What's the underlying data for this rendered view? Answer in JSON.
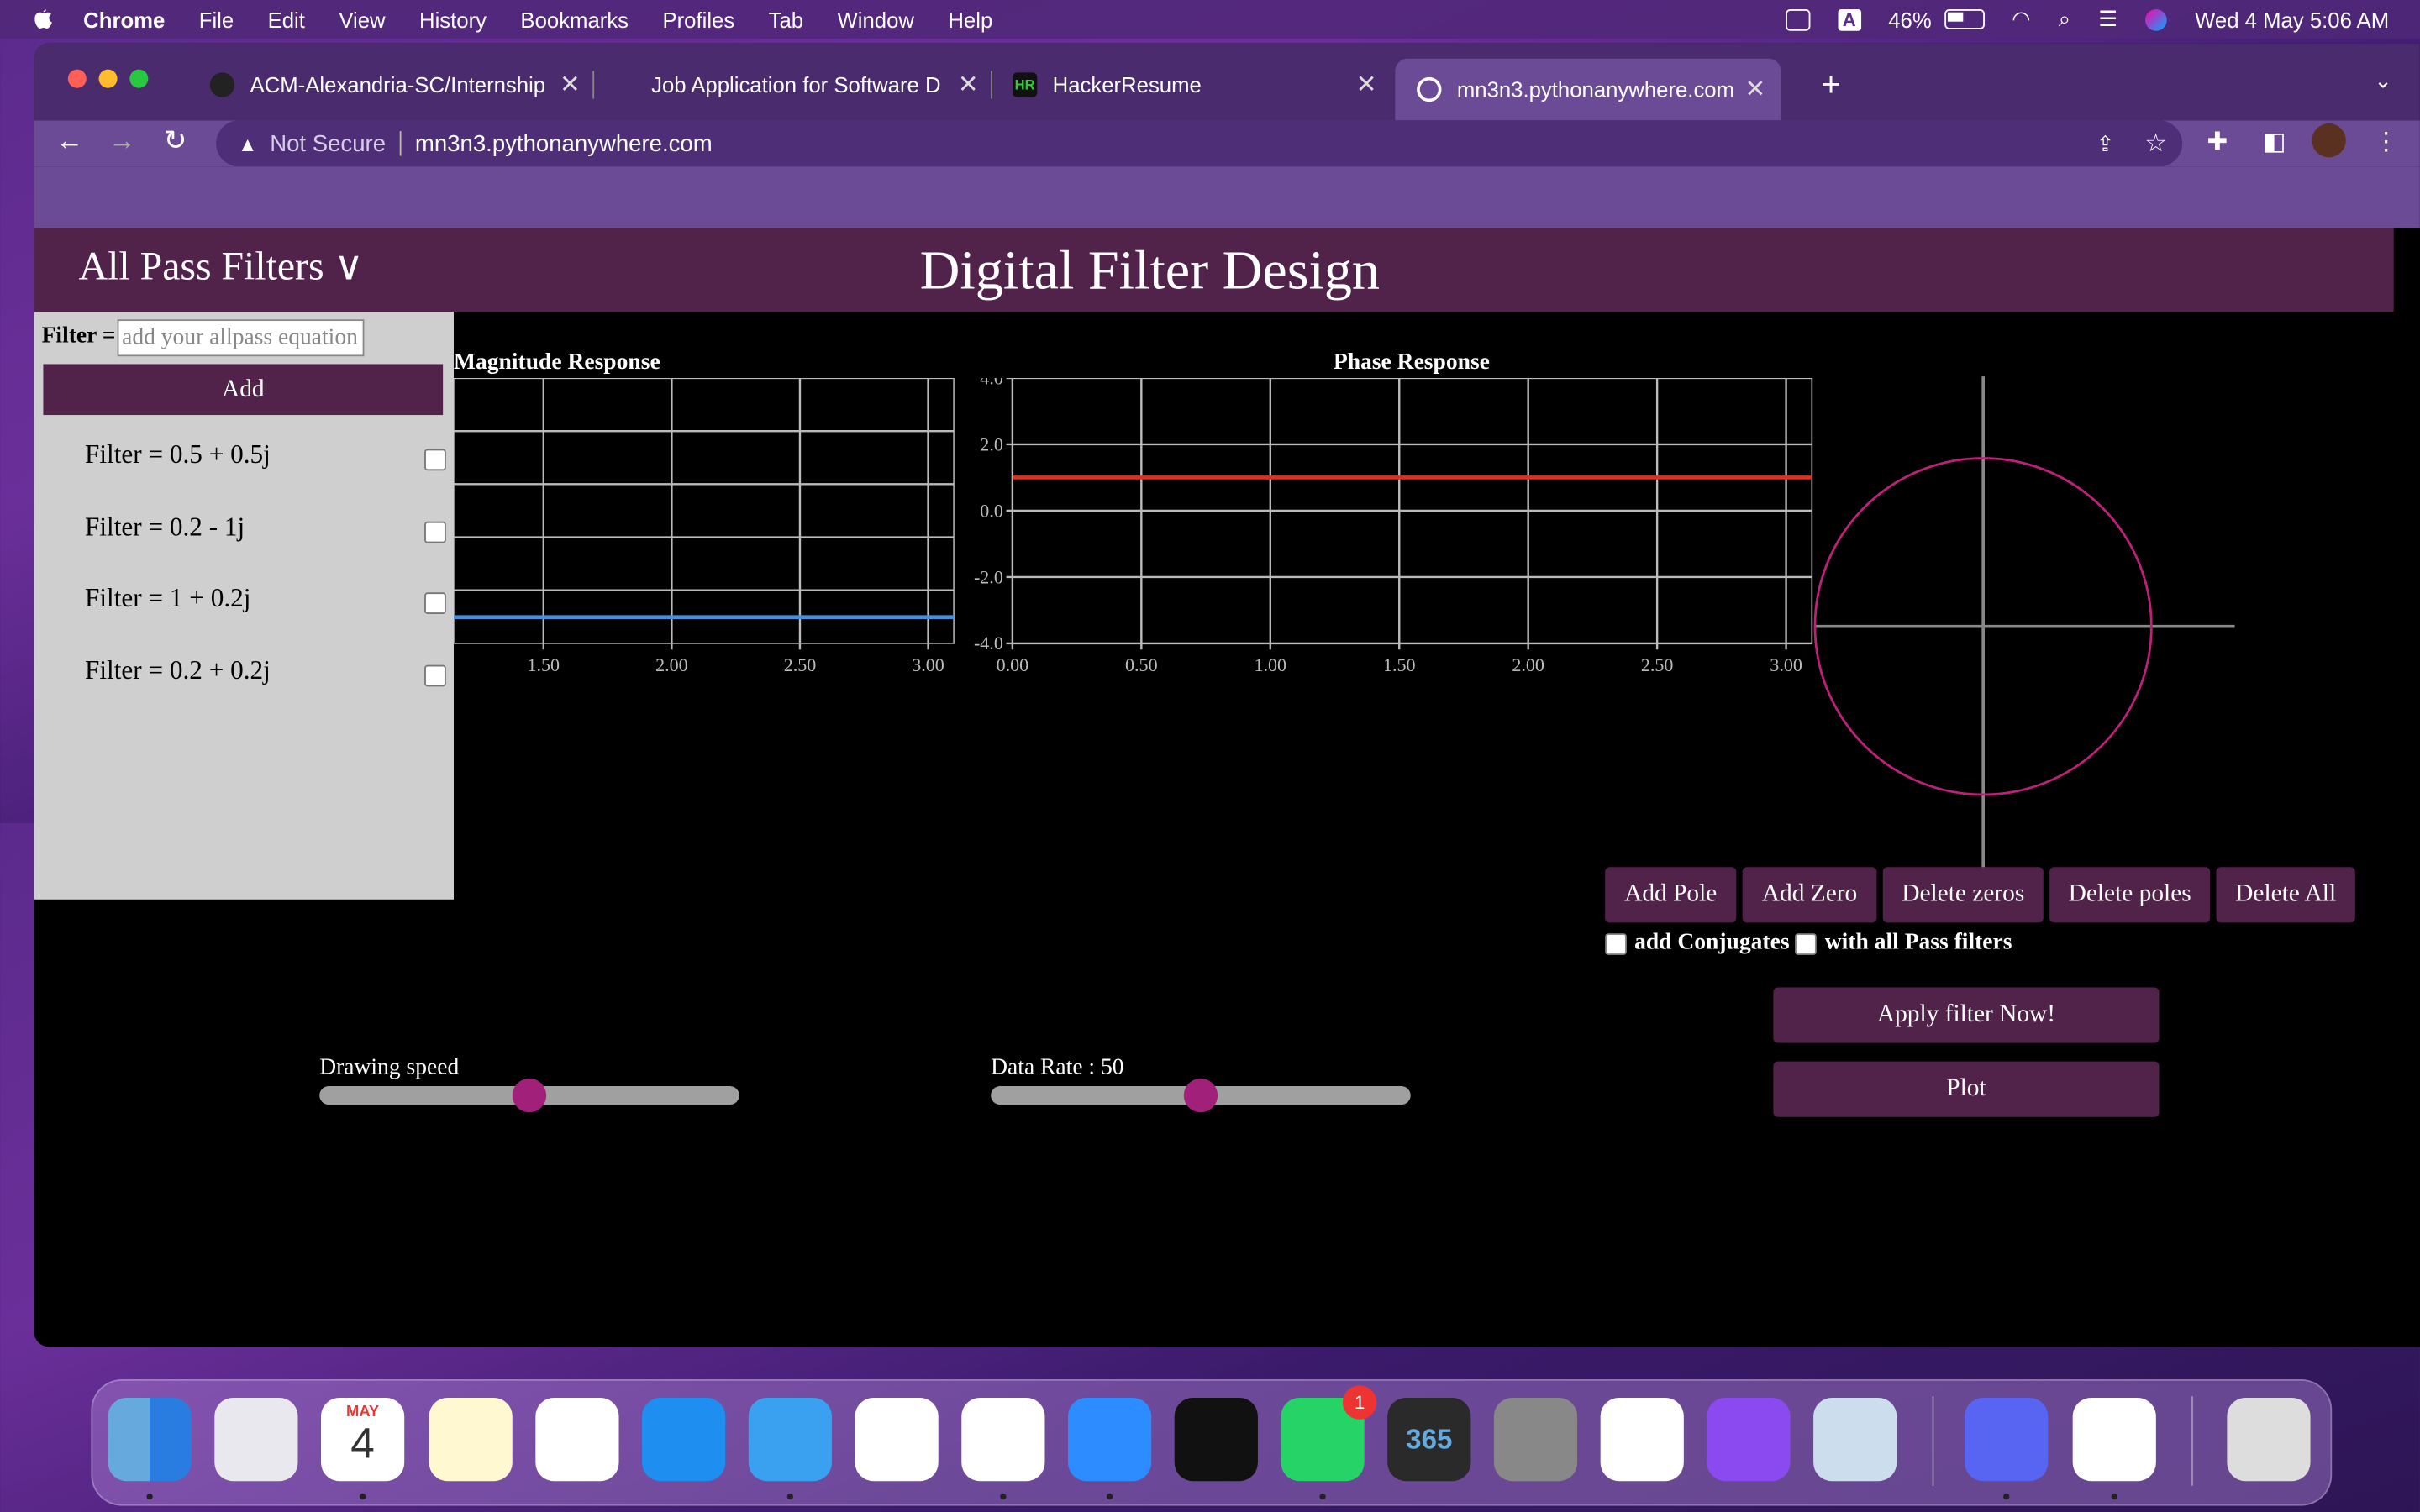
{
  "menubar": {
    "app": "Chrome",
    "items": [
      "File",
      "Edit",
      "View",
      "History",
      "Bookmarks",
      "Profiles",
      "Tab",
      "Window",
      "Help"
    ],
    "battery": "46%",
    "datetime": "Wed 4 May  5:06 AM"
  },
  "browser": {
    "tabs": [
      {
        "title": "ACM-Alexandria-SC/Internship"
      },
      {
        "title": "Job Application for Software D"
      },
      {
        "title": "HackerResume"
      },
      {
        "title": "mn3n3.pythonanywhere.com"
      }
    ],
    "address": {
      "security": "Not Secure",
      "url": "mn3n3.pythonanywhere.com"
    }
  },
  "page": {
    "dropdown_label": "All Pass Filters ∨",
    "title": "Digital Filter Design",
    "sidebar": {
      "filter_label": "Filter =",
      "filter_placeholder": "add your allpass equation",
      "add_label": "Add",
      "filters": [
        {
          "label": "Filter = 0.5 + 0.5j",
          "checked": false
        },
        {
          "label": "Filter = 0.2 - 1j",
          "checked": false
        },
        {
          "label": "Filter = 1 + 0.2j",
          "checked": false
        },
        {
          "label": "Filter = 0.2 + 0.2j",
          "checked": false
        }
      ]
    },
    "buttons": {
      "add_pole": "Add Pole",
      "add_zero": "Add Zero",
      "delete_zeros": "Delete zeros",
      "delete_poles": "Delete poles",
      "delete_all": "Delete All",
      "apply": "Apply filter Now!",
      "plot": "Plot"
    },
    "checkboxes": {
      "conjugates": "add Conjugates",
      "all_pass": "with all Pass filters"
    },
    "sliders": {
      "drawing_speed": {
        "label": "Drawing speed",
        "value": 0.5
      },
      "data_rate": {
        "label": "Data Rate : 50",
        "value": 0.5
      }
    }
  },
  "chart_data": [
    {
      "type": "line",
      "title": "Magnitude Response",
      "x_ticks": [
        "1.50",
        "2.00",
        "2.50",
        "3.00"
      ],
      "x": [
        1.15,
        3.1
      ],
      "series": [
        {
          "values": [
            0.1,
            0.1
          ],
          "color": "#4a90d9"
        }
      ],
      "grid": true
    },
    {
      "type": "line",
      "title": "Phase Response",
      "x_ticks": [
        "0.00",
        "0.50",
        "1.00",
        "1.50",
        "2.00",
        "2.50",
        "3.00"
      ],
      "y_ticks": [
        "4.0",
        "2.0",
        "0.0",
        "-2.0",
        "-4.0"
      ],
      "xlim": [
        0,
        3.1
      ],
      "ylim": [
        -4,
        4
      ],
      "x": [
        0,
        3.1
      ],
      "series": [
        {
          "values": [
            1.0,
            1.0
          ],
          "color": "#e03020"
        }
      ],
      "grid": true
    }
  ],
  "unit_circle": {
    "color": "#c0207a"
  },
  "dock": {
    "apps": [
      "finder-icon",
      "launchpad-icon",
      "calendar-icon",
      "notes-icon",
      "reminders-icon",
      "app-store-icon",
      "mail-icon",
      "vscode-icon",
      "chrome-icon",
      "zoom-icon",
      "terminal-icon",
      "whatsapp-icon",
      "365-icon",
      "system-preferences-icon",
      "slack-icon",
      "messenger-icon",
      "preview-icon",
      "discord-icon",
      "word-icon",
      "trash-icon"
    ],
    "calendar_month": "MAY",
    "calendar_day": "4",
    "whatsapp_badge": "1",
    "office_label": "365"
  }
}
